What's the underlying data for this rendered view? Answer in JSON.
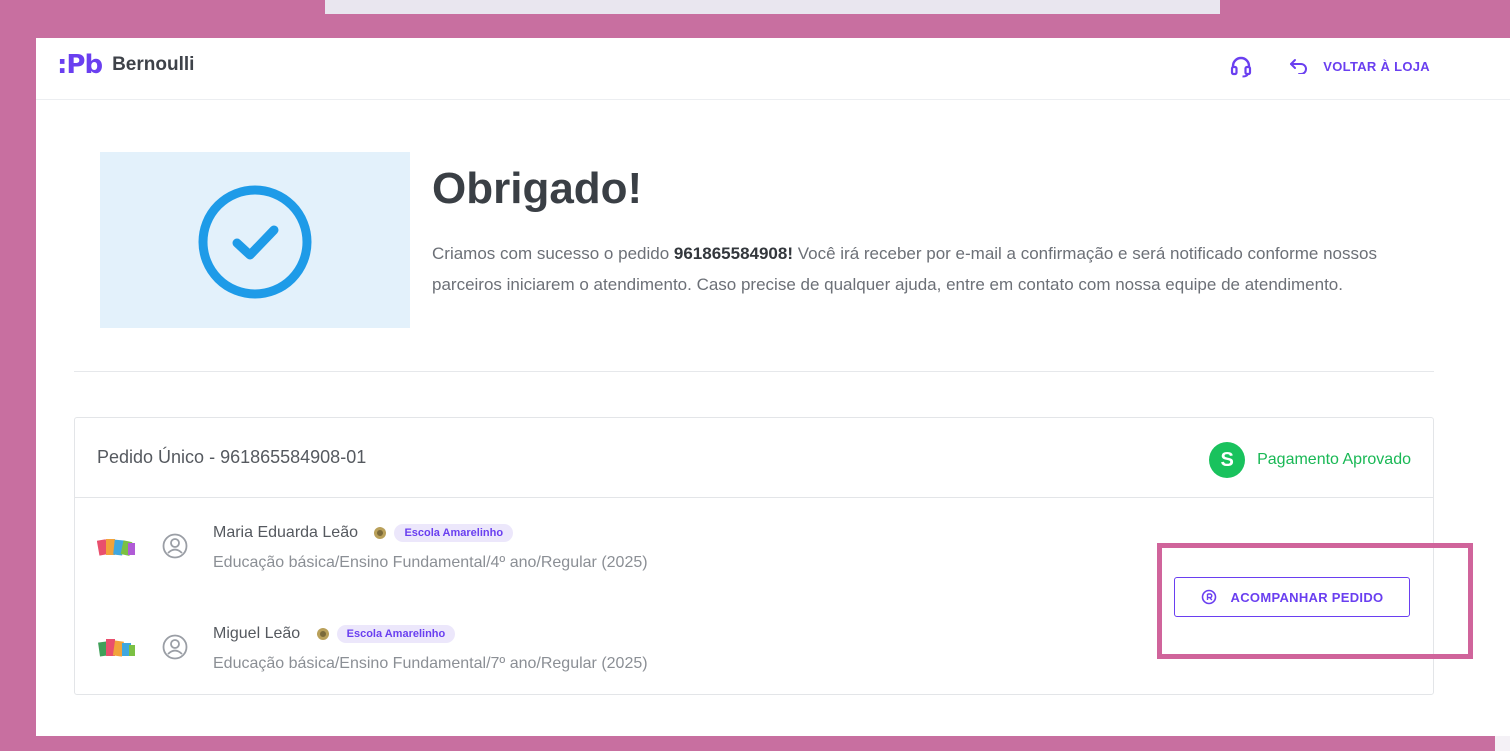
{
  "header": {
    "logo_mark": ":Pb",
    "brand_name": "Bernoulli",
    "support_icon": "headset-icon",
    "back_label": "VOLTAR À LOJA",
    "back_icon": "return-arrow-icon"
  },
  "hero": {
    "icon": "check-circle-icon",
    "title": "Obrigado!",
    "text_before": "Criamos com sucesso o pedido ",
    "order_number": "961865584908!",
    "text_after": " Você irá receber por e-mail a confirmação e será notificado conforme nossos parceiros iniciarem o atendimento. Caso precise de qualquer ajuda, entre em contato com nossa equipe de atendimento."
  },
  "order": {
    "title": "Pedido Único - 961865584908-01",
    "status_icon": "dollar-icon",
    "status_symbol": "S",
    "status_label": "Pagamento Aprovado",
    "status_color": "#19c25d",
    "students": [
      {
        "name": "Maria Eduarda Leão",
        "school": "Escola Amarelinho",
        "course": "Educação básica/Ensino Fundamental/4º ano/Regular (2025)"
      },
      {
        "name": "Miguel Leão",
        "school": "Escola Amarelinho",
        "course": "Educação básica/Ensino Fundamental/7º ano/Regular (2025)"
      }
    ],
    "track_button_label": "ACOMPANHAR PEDIDO",
    "track_icon": "radio-circle-icon"
  },
  "colors": {
    "brand": "#6a3ff0",
    "background": "#c86fa0",
    "success": "#19c25d",
    "highlight": "#d0649b"
  }
}
